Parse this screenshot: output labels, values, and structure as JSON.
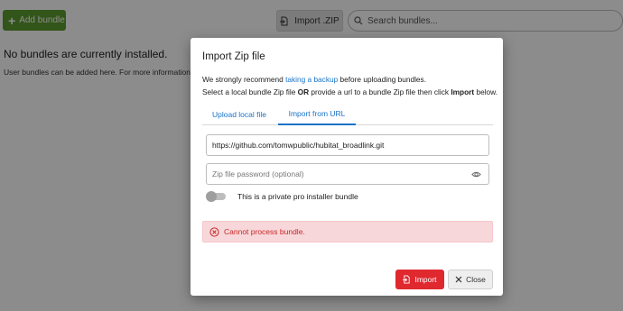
{
  "background": {
    "add_bundle_label": "Add bundle",
    "import_zip_label": "Import .ZIP",
    "search_placeholder": "Search bundles...",
    "empty_title": "No bundles are currently installed.",
    "empty_desc": "User bundles can be added here. For more information vi"
  },
  "dialog": {
    "title": "Import Zip file",
    "desc_line1_pre": "We strongly recommend ",
    "desc_line1_link": "taking a backup",
    "desc_line1_post": " before uploading bundles.",
    "desc_line2_pre": "Select a local bundle Zip file ",
    "desc_line2_or": "OR",
    "desc_line2_mid": " provide a url to a bundle Zip file then click ",
    "desc_line2_import": "Import",
    "desc_line2_post": " below.",
    "tabs": [
      {
        "label": "Upload local file",
        "active": false
      },
      {
        "label": "Import from URL",
        "active": true
      }
    ],
    "url_value": "https://github.com/tomwpublic/hubitat_broadlink.git",
    "password_placeholder": "Zip file password (optional)",
    "toggle_label": "This is a private pro installer bundle",
    "toggle_on": false,
    "error_text": "Cannot process bundle.",
    "import_button": "Import",
    "close_button": "Close"
  },
  "colors": {
    "accent": "#1a73c7",
    "add_button": "#5c9c2e",
    "import_button": "#e0282f",
    "error_bg": "#f8d7da",
    "error_text": "#c62828"
  }
}
